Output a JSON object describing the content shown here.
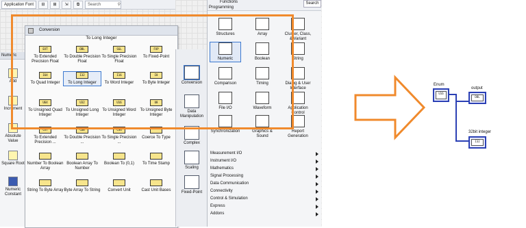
{
  "toolbar": {
    "font_label": "Application Font",
    "search_placeholder": "Search",
    "buttons": [
      "align",
      "distribute",
      "resize",
      "reorder",
      "cleanup"
    ]
  },
  "numeric_palette": {
    "header": "Numeric",
    "items": [
      "Add",
      "Increment",
      "Absolute Value",
      "Square Root",
      "Numeric Constant"
    ]
  },
  "conversion_palette": {
    "title": "Conversion",
    "hover_label": "To Long Integer",
    "items": [
      {
        "label": "To Extended Precision Float",
        "code": "EXT"
      },
      {
        "label": "To Double Precision Float",
        "code": "DBL"
      },
      {
        "label": "To Single Precision Float",
        "code": "SGL"
      },
      {
        "label": "To Fixed-Point",
        "code": "FXP"
      },
      {
        "label": "To Quad Integer",
        "code": "I64"
      },
      {
        "label": "To Long Integer",
        "code": "I32"
      },
      {
        "label": "To Word Integer",
        "code": "I16"
      },
      {
        "label": "To Byte Integer",
        "code": "I8"
      },
      {
        "label": "To Unsigned Quad Integer",
        "code": "U64"
      },
      {
        "label": "To Unsigned Long Integer",
        "code": "U32"
      },
      {
        "label": "To Unsigned Word Integer",
        "code": "U16"
      },
      {
        "label": "To Unsigned Byte Integer",
        "code": "U8"
      },
      {
        "label": "To Extended Precision ...",
        "code": "CXT"
      },
      {
        "label": "To Double Precision ...",
        "code": "CDB"
      },
      {
        "label": "To Single Precision ...",
        "code": "CSG"
      },
      {
        "label": "Coerce To Type",
        "code": ""
      },
      {
        "label": "Number To Boolean Array",
        "code": ""
      },
      {
        "label": "Boolean Array To Number",
        "code": ""
      },
      {
        "label": "Boolean To (0,1)",
        "code": ""
      },
      {
        "label": "To Time Stamp",
        "code": ""
      },
      {
        "label": "String To Byte Array",
        "code": ""
      },
      {
        "label": "Byte Array To String",
        "code": ""
      },
      {
        "label": "Convert Unit",
        "code": ""
      },
      {
        "label": "Cast Unit Bases",
        "code": ""
      }
    ]
  },
  "category_column": {
    "items": [
      "Conversion",
      "Data Manipulation",
      "Complex",
      "Scaling",
      "Fixed-Point"
    ]
  },
  "functions_palette": {
    "title": "Functions",
    "subtitle": "Programming",
    "search_label": "Search",
    "items": [
      "Structures",
      "Array",
      "Cluster, Class, & Variant",
      "Numeric",
      "Boolean",
      "String",
      "Comparison",
      "Timing",
      "Dialog & User Interface",
      "File I/O",
      "Waveform",
      "Application Control",
      "Synchronization",
      "Graphics & Sound",
      "Report Generation"
    ],
    "submenus": [
      "Measurement I/O",
      "Instrument I/O",
      "Mathematics",
      "Signal Processing",
      "Data Communication",
      "Connectivity",
      "Control & Simulation",
      "Express",
      "Addons"
    ]
  },
  "diagram": {
    "enum_label": "Enum",
    "output_label": "output",
    "int_label": "32bit integer",
    "enum_code": "U16",
    "output_code": "DBL",
    "int_code": "I32",
    "wire_color": "#2a3fb4"
  },
  "colors": {
    "highlight": "#f08a2c",
    "selection": "#3b78d0"
  }
}
